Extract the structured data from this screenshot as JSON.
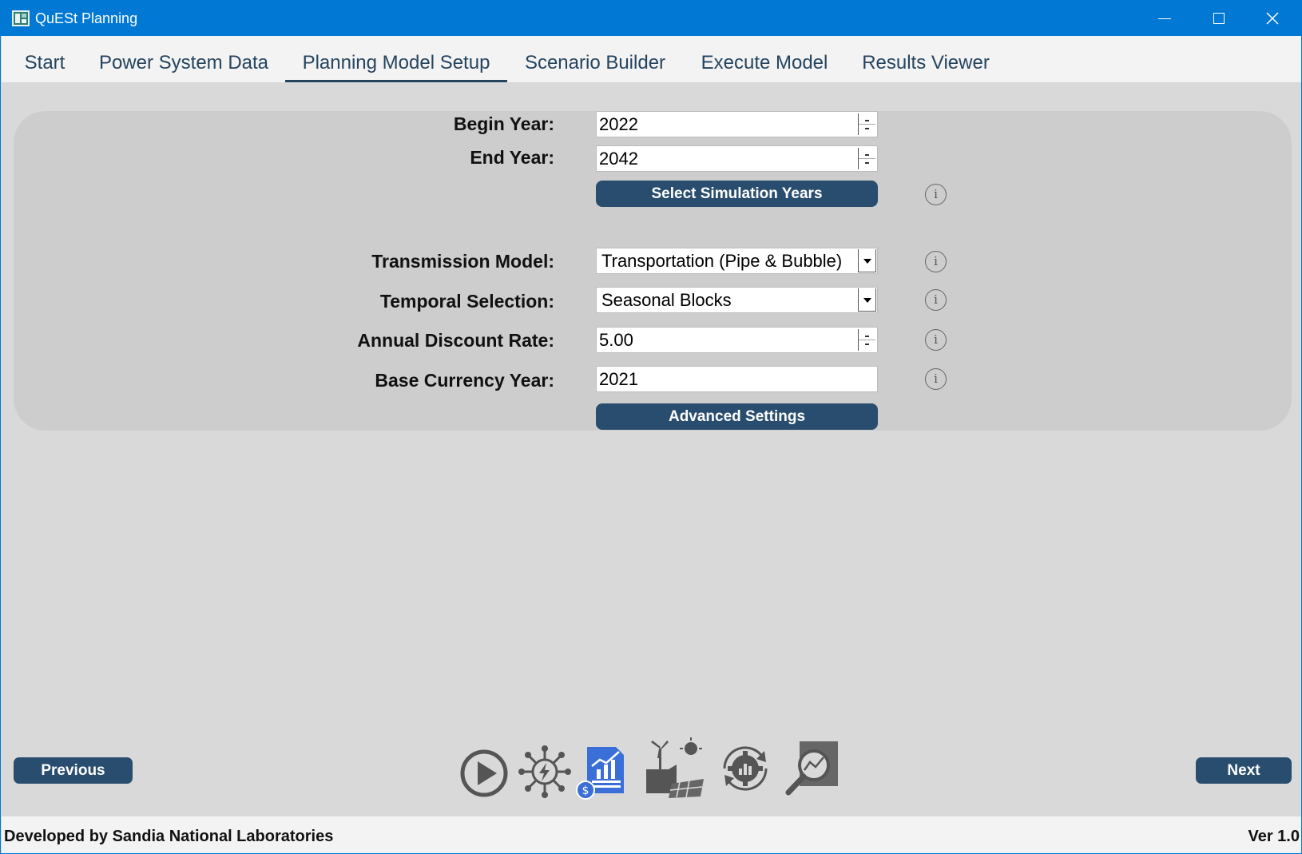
{
  "window": {
    "title": "QuESt Planning"
  },
  "tabs": [
    {
      "label": "Start"
    },
    {
      "label": "Power System Data"
    },
    {
      "label": "Planning Model Setup"
    },
    {
      "label": "Scenario Builder"
    },
    {
      "label": "Execute Model"
    },
    {
      "label": "Results Viewer"
    }
  ],
  "active_tab": "Planning Model Setup",
  "form": {
    "begin_year": {
      "label": "Begin Year:",
      "value": "2022"
    },
    "end_year": {
      "label": "End Year:",
      "value": "2042"
    },
    "select_years_button": "Select Simulation Years",
    "transmission_model": {
      "label": "Transmission Model:",
      "value": "Transportation (Pipe & Bubble)"
    },
    "temporal_selection": {
      "label": "Temporal Selection:",
      "value": "Seasonal Blocks"
    },
    "discount_rate": {
      "label": "Annual Discount Rate:",
      "value": "5.00"
    },
    "base_currency_year": {
      "label": "Base Currency Year:",
      "value": "2021"
    },
    "advanced_button": "Advanced Settings",
    "info_glyph": "i"
  },
  "navigation": {
    "previous": "Previous",
    "next": "Next"
  },
  "workflow_icons": [
    "play-icon",
    "power-network-icon",
    "cost-report-icon",
    "generation-resources-icon",
    "optimization-gear-icon",
    "results-analysis-icon"
  ],
  "footer": {
    "developer": "Developed by Sandia National Laboratories",
    "version": "Ver 1.0"
  },
  "colors": {
    "titlebar": "#0078d4",
    "accent": "#294d6e",
    "panel": "#cdcdcd",
    "background": "#d9d9d9",
    "active_icon_blue": "#3a6fd8"
  }
}
